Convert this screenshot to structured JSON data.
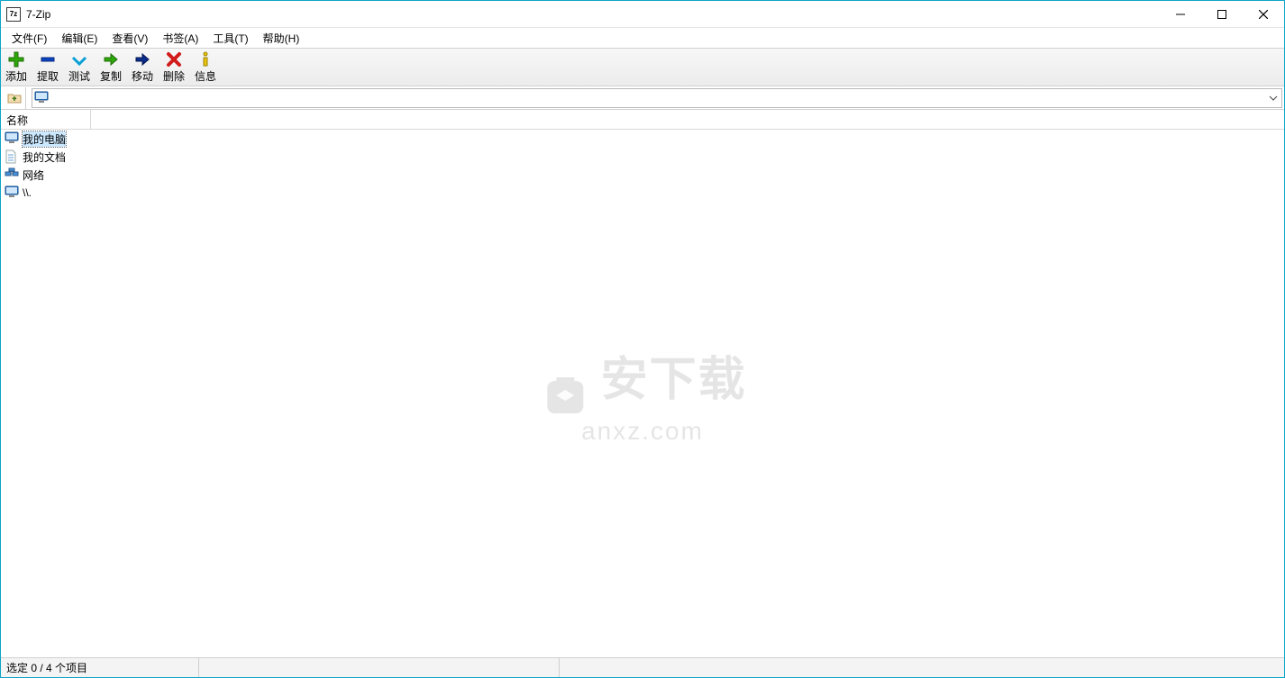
{
  "window": {
    "title": "7-Zip",
    "app_icon_text": "7z"
  },
  "menubar": {
    "file": "文件(F)",
    "edit": "编辑(E)",
    "view": "查看(V)",
    "bookmarks": "书签(A)",
    "tools": "工具(T)",
    "help": "帮助(H)"
  },
  "toolbar": {
    "add": "添加",
    "extract": "提取",
    "test": "测试",
    "copy": "复制",
    "move": "移动",
    "delete": "删除",
    "info": "信息"
  },
  "addressbar": {
    "path": ""
  },
  "columns": {
    "name": "名称"
  },
  "items": [
    {
      "label": "我的电脑",
      "icon": "computer",
      "selected": true
    },
    {
      "label": "我的文档",
      "icon": "document",
      "selected": false
    },
    {
      "label": "网络",
      "icon": "network",
      "selected": false
    },
    {
      "label": "\\\\.",
      "icon": "computer",
      "selected": false
    }
  ],
  "statusbar": {
    "selection": "选定 0 / 4 个项目"
  },
  "watermark": {
    "main": "安下载",
    "sub": "anxz.com"
  }
}
